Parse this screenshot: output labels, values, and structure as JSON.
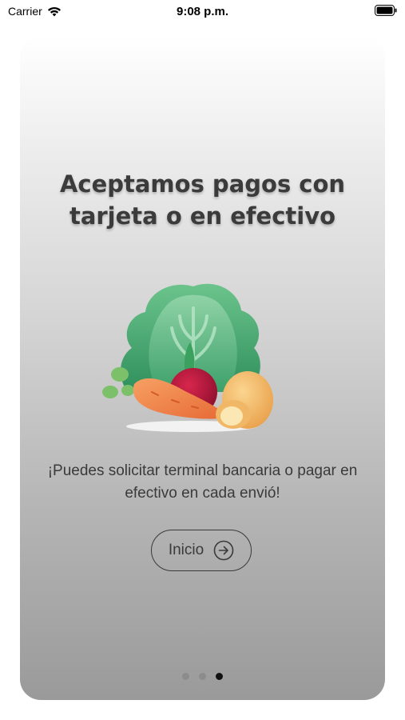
{
  "status_bar": {
    "carrier": "Carrier",
    "time": "9:08 p.m."
  },
  "onboarding": {
    "title": "Aceptamos pagos con tarjeta o en efectivo",
    "description": "¡Puedes solicitar terminal bancaria o pagar en efectivo en cada envió!",
    "button_label": "Inicio",
    "button_icon": "arrow-right-circle-icon",
    "illustration": "vegetables-illustration",
    "pages": {
      "total": 3,
      "current": 3
    }
  },
  "colors": {
    "title_text": "#3b3b3b",
    "body_text": "#3a3a3a",
    "dot_inactive": "#8c8c8c",
    "dot_active": "#111111"
  }
}
